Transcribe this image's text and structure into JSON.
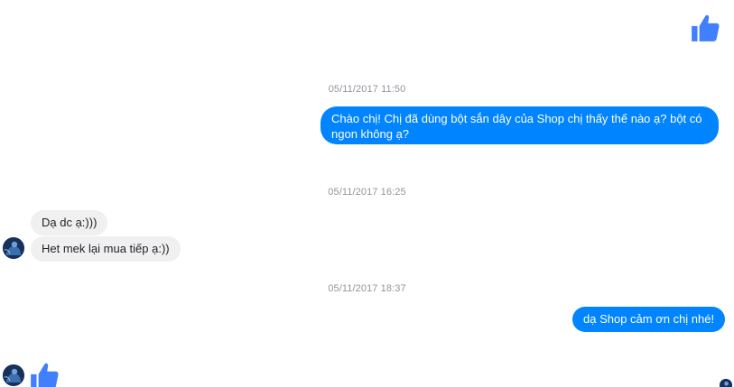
{
  "messages": {
    "ts1": "05/11/2017 11:50",
    "out1": "Chào chị! Chị đã dùng bột sắn dây của Shop chị thấy thế nào ạ? bột có ngon không ạ?",
    "ts2": "05/11/2017 16:25",
    "in1": "Dạ dc ạ:)))",
    "in2": "Het mek lại mua tiếp ạ:))",
    "ts3": "05/11/2017 18:37",
    "out2": "dạ Shop cảm ơn chị nhé!"
  },
  "colors": {
    "outgoing_bubble": "#0084ff",
    "incoming_bubble": "#f1f0f0",
    "like_icon": "#4080ff",
    "timestamp_text": "#90949c"
  },
  "icons": {
    "top_right": "thumbs-up-icon",
    "bottom_left": "thumbs-up-icon"
  }
}
